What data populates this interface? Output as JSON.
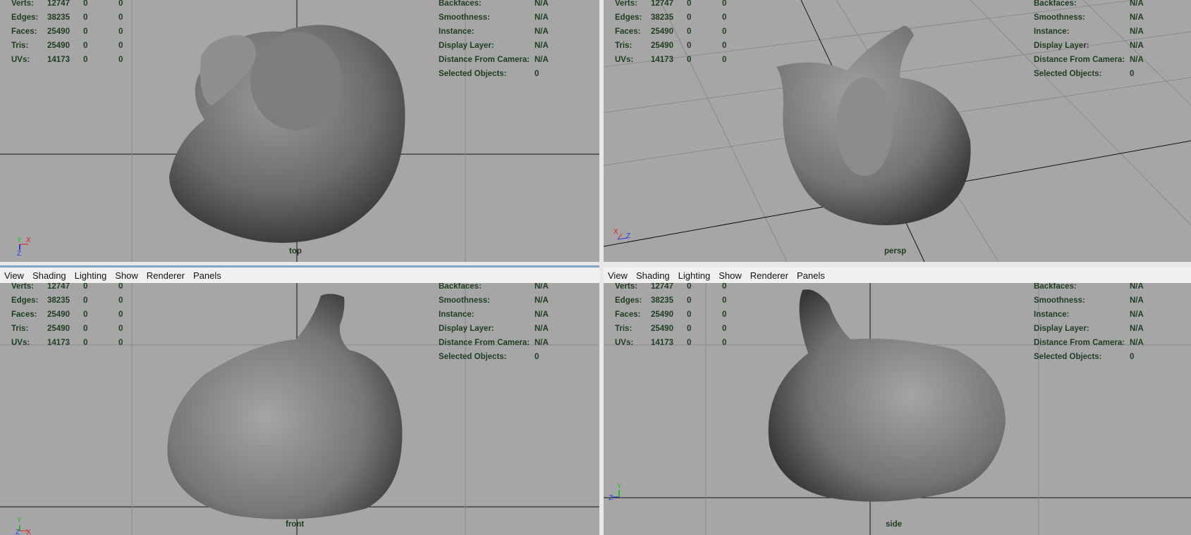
{
  "menu": [
    "View",
    "Shading",
    "Lighting",
    "Show",
    "Renderer",
    "Panels"
  ],
  "poly_stats": [
    {
      "label": "Verts:",
      "values": [
        "12747",
        "0",
        "0"
      ]
    },
    {
      "label": "Edges:",
      "values": [
        "38235",
        "0",
        "0"
      ]
    },
    {
      "label": "Faces:",
      "values": [
        "25490",
        "0",
        "0"
      ]
    },
    {
      "label": "Tris:",
      "values": [
        "25490",
        "0",
        "0"
      ]
    },
    {
      "label": "UVs:",
      "values": [
        "14173",
        "0",
        "0"
      ]
    }
  ],
  "object_stats": [
    {
      "label": "Backfaces:",
      "value": "N/A"
    },
    {
      "label": "Smoothness:",
      "value": "N/A"
    },
    {
      "label": "Instance:",
      "value": "N/A"
    },
    {
      "label": "Display Layer:",
      "value": "N/A"
    },
    {
      "label": "Distance From Camera:",
      "value": "N/A"
    },
    {
      "label": "Selected Objects:",
      "value": "0"
    }
  ],
  "viewports": {
    "top": {
      "camera": "top",
      "axes": [
        "Y",
        "X",
        "Z"
      ]
    },
    "persp": {
      "camera": "persp",
      "axes": [
        "X",
        "Z"
      ]
    },
    "front": {
      "camera": "front",
      "axes": [
        "Y",
        "Z",
        "X"
      ]
    },
    "side": {
      "camera": "side",
      "axes": [
        "Y",
        "Z"
      ]
    }
  },
  "colors": {
    "viewport_bg": "#a6a6a6",
    "hud_text": "#1e3d20",
    "axis_x": "#e02020",
    "axis_y": "#20c020",
    "axis_z": "#2040e0"
  }
}
